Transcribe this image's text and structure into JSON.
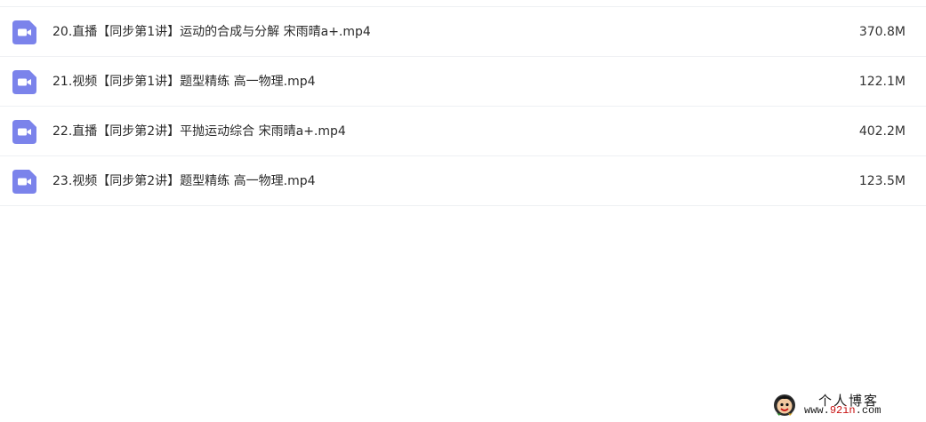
{
  "colors": {
    "icon_bg": "#7B83EB",
    "icon_fg": "#FFFFFF",
    "text": "#2A2A2A",
    "divider": "#EEF0F3"
  },
  "files": [
    {
      "icon": "video-file-icon",
      "name": "20.直播【同步第1讲】运动的合成与分解 宋雨晴a+.mp4",
      "size": "370.8M"
    },
    {
      "icon": "video-file-icon",
      "name": "21.视频【同步第1讲】题型精练 高一物理.mp4",
      "size": "122.1M"
    },
    {
      "icon": "video-file-icon",
      "name": "22.直播【同步第2讲】平抛运动综合 宋雨晴a+.mp4",
      "size": "402.2M"
    },
    {
      "icon": "video-file-icon",
      "name": "23.视频【同步第2讲】题型精练 高一物理.mp4",
      "size": "123.5M"
    }
  ],
  "watermark": {
    "title": "个人博客",
    "url_prefix": "www.",
    "url_accent": "92in",
    "url_suffix": ".com"
  }
}
